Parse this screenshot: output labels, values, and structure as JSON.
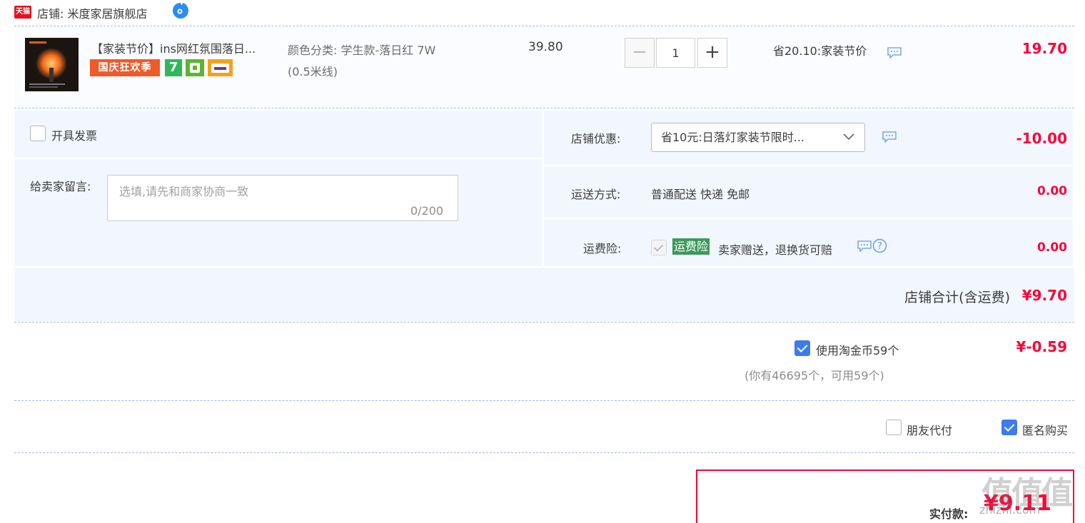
{
  "store": {
    "logo_text": "天猫",
    "label": "店铺: 米度家居旗舰店"
  },
  "item": {
    "title": "【家装节价】ins网红氛围落日...",
    "badges": {
      "festival": "国庆狂欢季",
      "seven": "7"
    },
    "sku_line1": "颜色分类: 学生款-落日红 7W",
    "sku_line2": "(0.5米线)",
    "unit_price": "39.80",
    "quantity": "1",
    "minus": "−",
    "plus": "+",
    "saving": "省20.10:家装节价",
    "total": "19.70"
  },
  "invoice": {
    "label": "开具发票",
    "checked": false
  },
  "message": {
    "label": "给卖家留言:",
    "placeholder": "选填,请先和商家协商一致",
    "count": "0/200"
  },
  "coupon": {
    "label": "店铺优惠:",
    "value": "省10元:日落灯家装节限时...",
    "amount": "-10.00"
  },
  "shipping": {
    "label": "运送方式:",
    "value": "普通配送 快递 免邮",
    "amount": "0.00"
  },
  "insurance": {
    "label": "运费险:",
    "tag": "运费险",
    "desc": "卖家赠送，退换货可赔",
    "amount": "0.00"
  },
  "summary": {
    "label": "店铺合计(含运费)",
    "amount": "¥9.70"
  },
  "coins": {
    "label": "使用淘金币59个",
    "sub": "(你有46695个，可用59个)",
    "amount": "¥-0.59",
    "checked": true
  },
  "options": {
    "friend_pay": "朋友代付",
    "anonymous": "匿名购买"
  },
  "payment": {
    "label": "实付款:",
    "amount": "¥9.11"
  },
  "watermark": {
    "text": "值值值",
    "sub": "zhizhi.com"
  },
  "colors": {
    "accent_red": "#ff0036",
    "panel_bg": "#f2f7ff",
    "checkbox_blue": "#3c7bf0"
  }
}
